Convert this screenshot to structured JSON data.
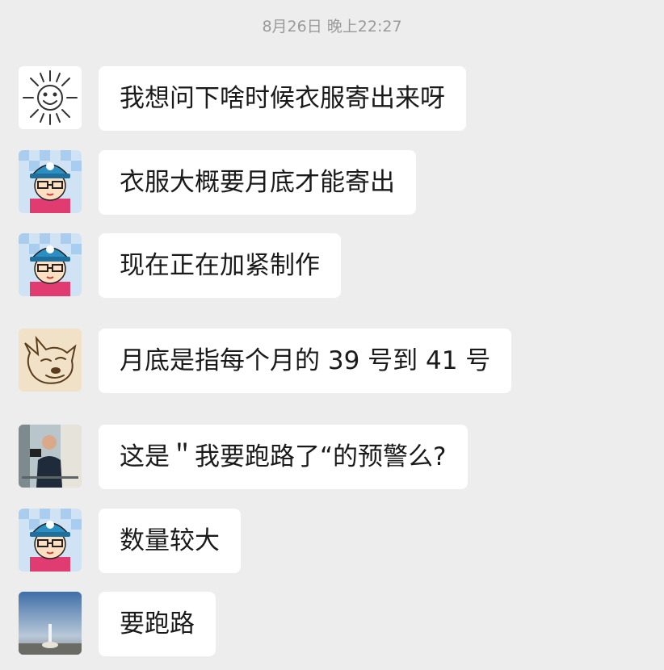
{
  "chat": {
    "timestamp": "8月26日 晚上22:27",
    "messages": [
      {
        "sender_avatar": "sun-face-icon",
        "text": "我想问下啥时候衣服寄出来呀"
      },
      {
        "sender_avatar": "cartoon-boy-cap-icon",
        "text": "衣服大概要月底才能寄出"
      },
      {
        "sender_avatar": "cartoon-boy-cap-icon",
        "text": "现在正在加紧制作"
      },
      {
        "sender_avatar": "doge-sketch-icon",
        "text": "月底是指每个月的 39 号到 41 号"
      },
      {
        "sender_avatar": "person-photo-icon",
        "text": "这是＂我要跑路了“的预警么?"
      },
      {
        "sender_avatar": "cartoon-boy-cap-icon",
        "text": "数量较大"
      },
      {
        "sender_avatar": "rocket-launch-photo-icon",
        "text": "要跑路"
      }
    ]
  },
  "colors": {
    "background": "#ededed",
    "bubble": "#ffffff",
    "timestamp_text": "#9a9a9a",
    "cap_blue": "#2b8fc4",
    "shirt_pink": "#e03c72"
  }
}
